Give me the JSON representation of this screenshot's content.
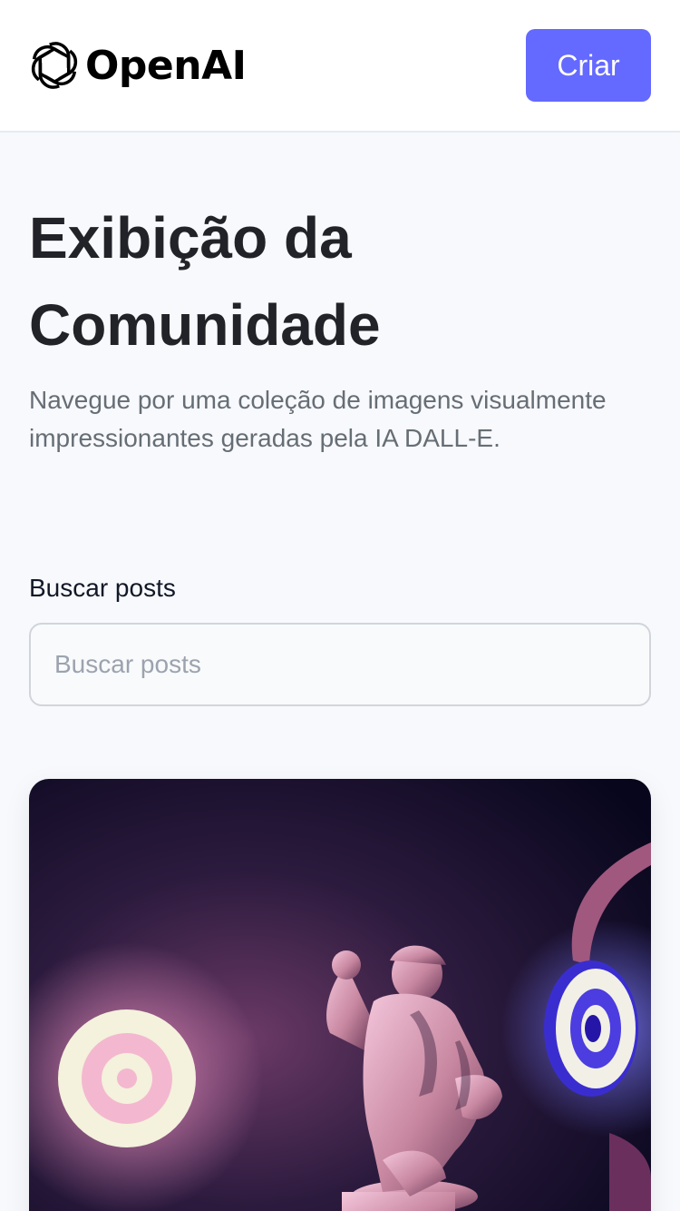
{
  "header": {
    "brand_name": "OpenAI",
    "brand_icon": "openai-logo-icon",
    "create_label": "Criar"
  },
  "hero": {
    "title_line1": "Exibição da",
    "title_line2": "Comunidade",
    "subtitle": "Navegue por uma coleção de imagens visualmente impressionantes geradas pela IA DALL-E."
  },
  "search": {
    "label": "Buscar posts",
    "placeholder": "Buscar posts",
    "value": ""
  },
  "colors": {
    "accent": "#6469ff",
    "background": "#f8f9fd",
    "title": "#222328",
    "subtitle": "#666e75"
  }
}
